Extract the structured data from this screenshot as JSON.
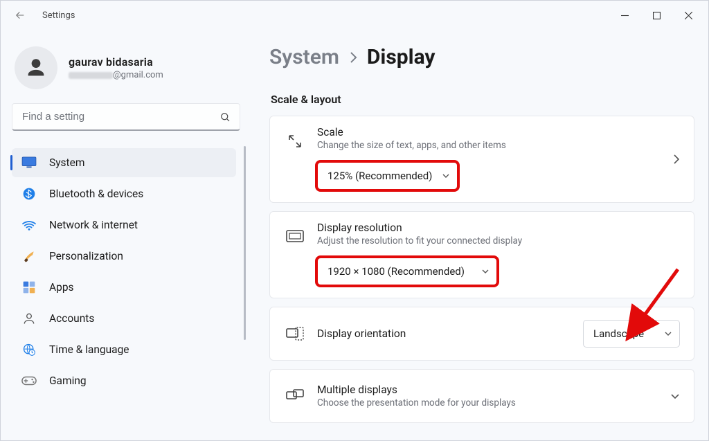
{
  "window": {
    "title": "Settings"
  },
  "profile": {
    "name": "gaurav bidasaria",
    "email_suffix": "@gmail.com"
  },
  "search": {
    "placeholder": "Find a setting"
  },
  "sidebar": {
    "items": [
      {
        "label": "System",
        "icon": "monitor"
      },
      {
        "label": "Bluetooth & devices",
        "icon": "bluetooth"
      },
      {
        "label": "Network & internet",
        "icon": "wifi"
      },
      {
        "label": "Personalization",
        "icon": "brush"
      },
      {
        "label": "Apps",
        "icon": "apps"
      },
      {
        "label": "Accounts",
        "icon": "person"
      },
      {
        "label": "Time & language",
        "icon": "globe-clock"
      },
      {
        "label": "Gaming",
        "icon": "gamepad"
      }
    ]
  },
  "breadcrumb": {
    "parent": "System",
    "title": "Display"
  },
  "section": {
    "scale_layout": "Scale & layout"
  },
  "cards": {
    "scale": {
      "title": "Scale",
      "desc": "Change the size of text, apps, and other items",
      "value": "125% (Recommended)"
    },
    "resolution": {
      "title": "Display resolution",
      "desc": "Adjust the resolution to fit your connected display",
      "value": "1920 × 1080 (Recommended)"
    },
    "orientation": {
      "title": "Display orientation",
      "value": "Landscape"
    },
    "multiple": {
      "title": "Multiple displays",
      "desc": "Choose the presentation mode for your displays"
    }
  },
  "annotation": {
    "arrow_target": "orientation-select",
    "color": "#e20a0a"
  }
}
